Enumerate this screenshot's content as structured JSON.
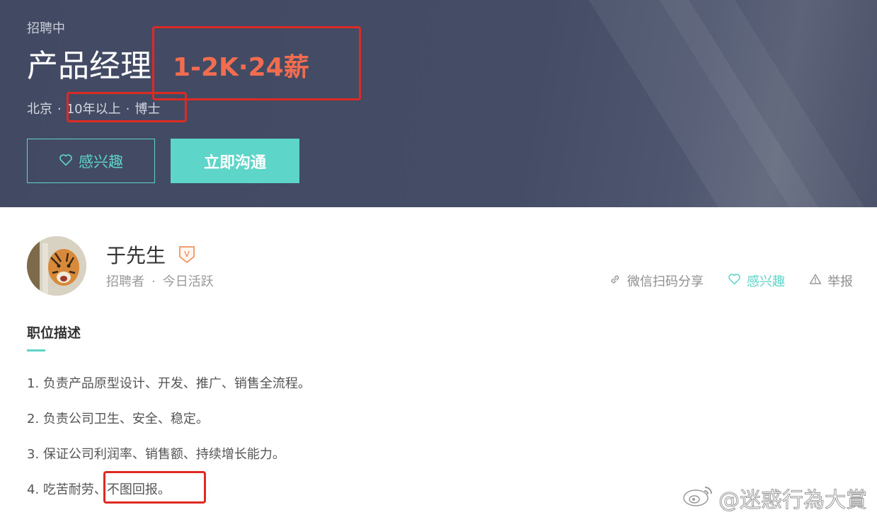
{
  "header": {
    "status": "招聘中",
    "title": "产品经理",
    "salary": "1-2K·24薪",
    "meta": {
      "city": "北京",
      "experience": "10年以上",
      "education": "博士",
      "separator": "·"
    },
    "buttons": {
      "interest_label": "感兴趣",
      "chat_label": "立即沟通"
    }
  },
  "recruiter": {
    "name": "于先生",
    "badge": "V",
    "role": "招聘者",
    "separator": "·",
    "activity": "今日活跃"
  },
  "actions": {
    "share_label": "微信扫码分享",
    "interest_label": "感兴趣",
    "report_label": "举报"
  },
  "description": {
    "title": "职位描述",
    "items": [
      "1. 负责产品原型设计、开发、推广、销售全流程。",
      "2. 负责公司卫生、安全、稳定。",
      "3. 保证公司利润率、销售额、持续增长能力。",
      "4. 吃苦耐劳、不图回报。"
    ]
  },
  "watermark": "@迷惑行為大賞",
  "colors": {
    "header_bg": "#444c66",
    "accent_teal": "#5dd5c8",
    "salary_orange": "#f26d4f",
    "annotation_red": "#dd2b23"
  },
  "icons": {
    "interest_button": "heart-outline-icon",
    "verified": "verified-badge-icon",
    "share": "link-icon",
    "interest_action": "heart-outline-icon",
    "report": "warning-triangle-icon",
    "watermark": "weibo-logo-icon"
  }
}
